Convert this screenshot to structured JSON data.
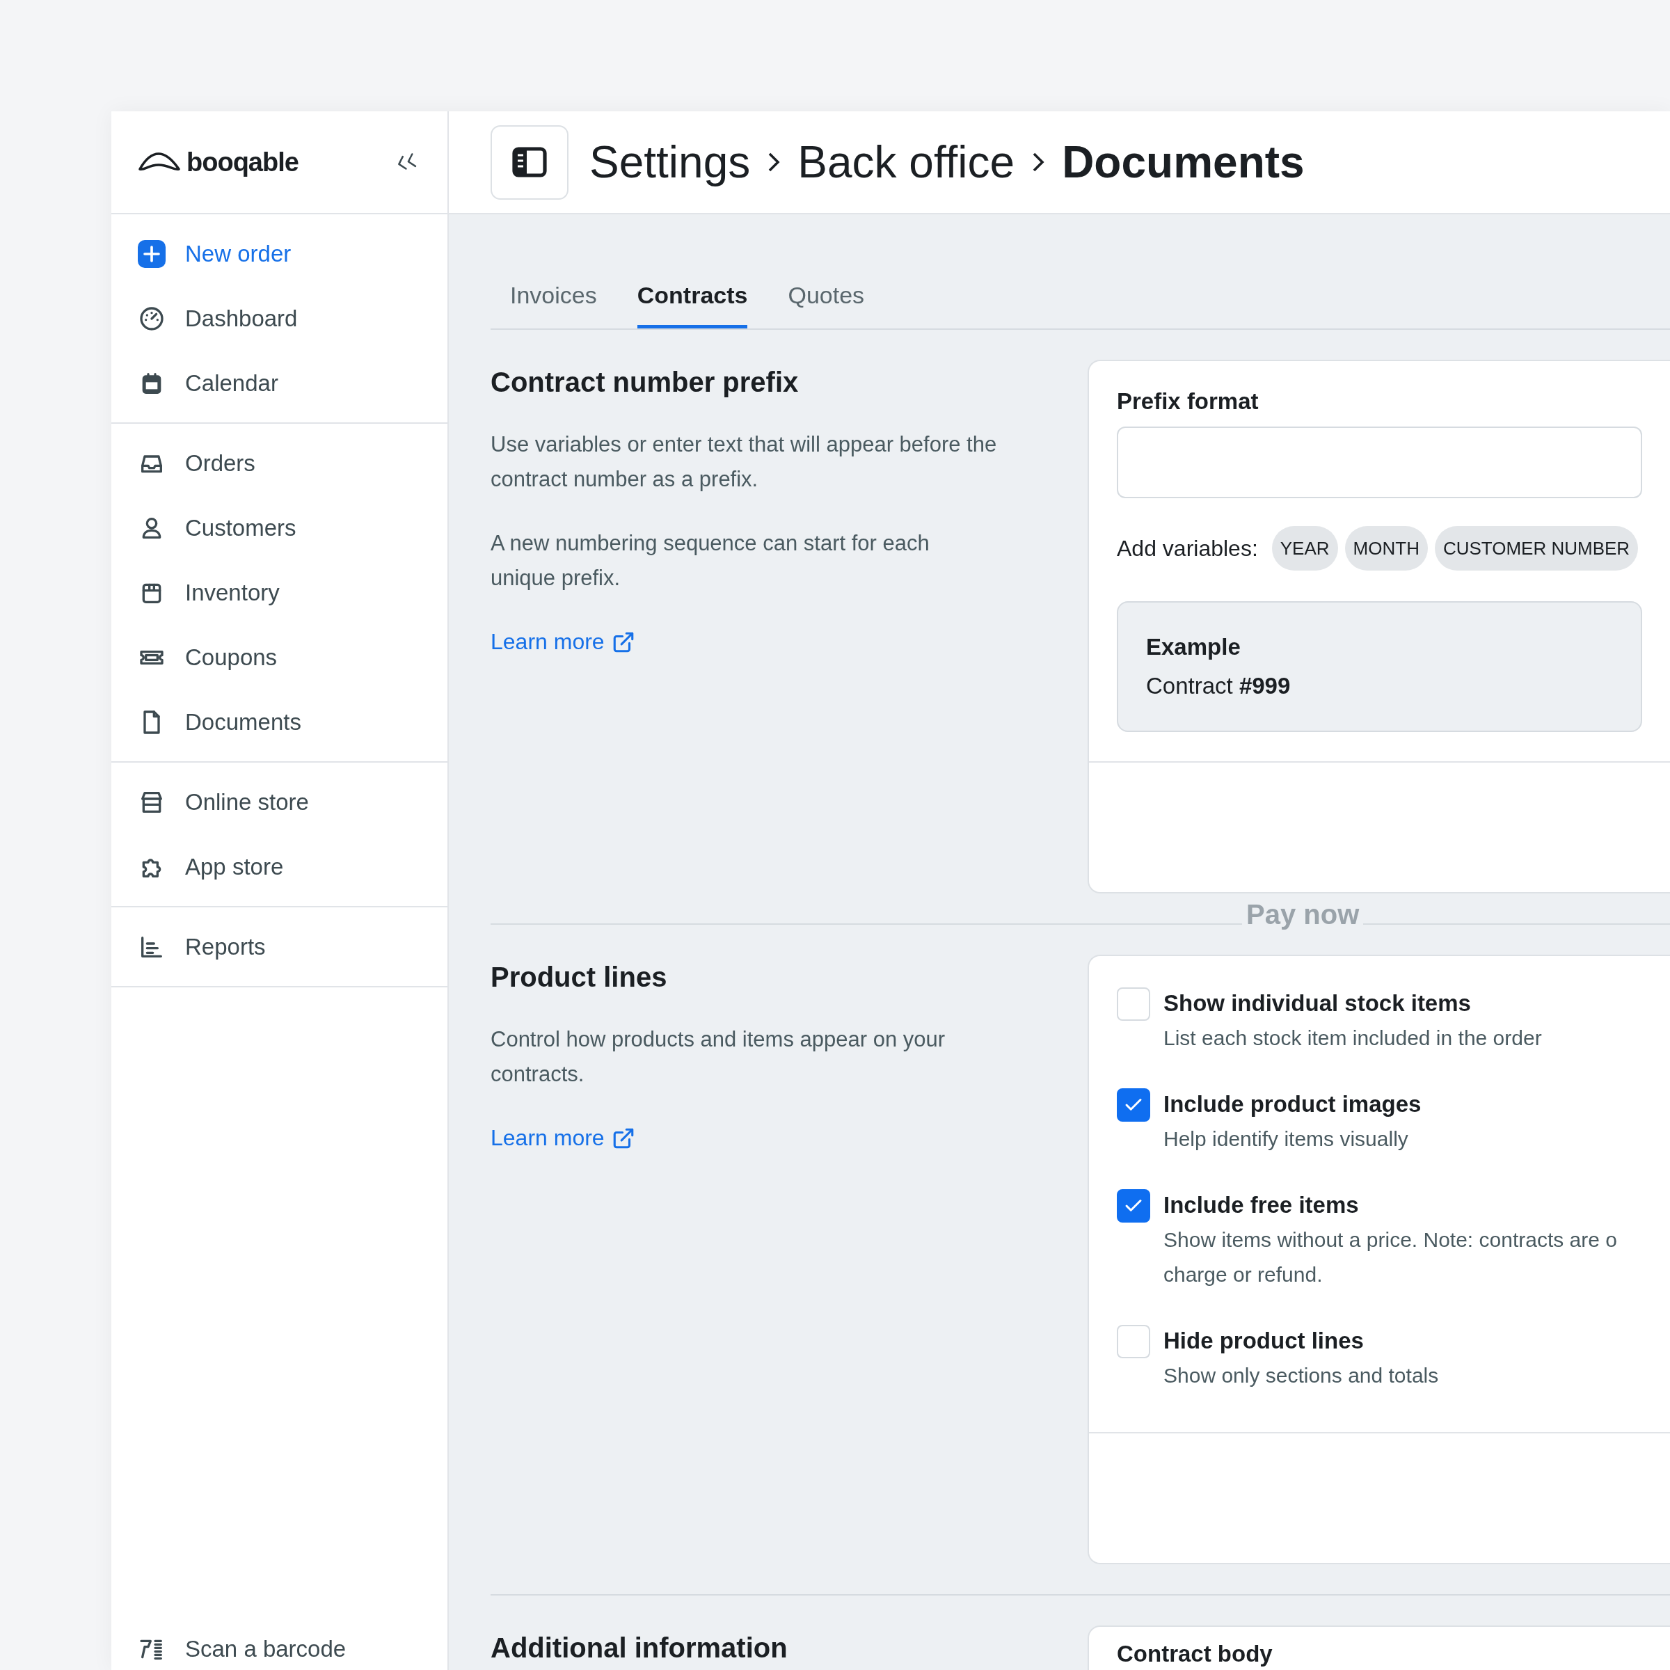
{
  "sidebar": {
    "logo": "booqable",
    "groups": [
      {
        "items": [
          {
            "label": "New order",
            "kind": "action"
          },
          {
            "label": "Dashboard",
            "kind": "link"
          },
          {
            "label": "Calendar",
            "kind": "link"
          }
        ]
      },
      {
        "items": [
          {
            "label": "Orders",
            "kind": "link"
          },
          {
            "label": "Customers",
            "kind": "link"
          },
          {
            "label": "Inventory",
            "kind": "link"
          },
          {
            "label": "Coupons",
            "kind": "link"
          },
          {
            "label": "Documents",
            "kind": "link"
          }
        ]
      },
      {
        "items": [
          {
            "label": "Online store",
            "kind": "link"
          },
          {
            "label": "App store",
            "kind": "link"
          }
        ]
      },
      {
        "items": [
          {
            "label": "Reports",
            "kind": "link"
          }
        ]
      }
    ],
    "footer_item": {
      "label": "Scan a barcode"
    }
  },
  "header": {
    "breadcrumbs": [
      {
        "label": "Settings",
        "current": false
      },
      {
        "label": "Back office",
        "current": false
      },
      {
        "label": "Documents",
        "current": true
      }
    ]
  },
  "tabs": [
    {
      "label": "Invoices",
      "selected": false
    },
    {
      "label": "Contracts",
      "selected": true
    },
    {
      "label": "Quotes",
      "selected": false
    }
  ],
  "sections": [
    {
      "title": "Contract number prefix",
      "paragraphs": [
        "Use variables or enter text that will appear before the contract number as a prefix.",
        "A new numbering sequence can start for each unique prefix."
      ],
      "link": "Learn more",
      "card": {
        "kind": "prefix",
        "label": "Prefix format",
        "variables_label": "Add variables:",
        "variables": [
          "YEAR",
          "MONTH",
          "CUSTOMER NUMBER"
        ],
        "example": {
          "title": "Example",
          "text": "Contract **#999**"
        }
      }
    },
    {
      "title": "Product lines",
      "paragraphs": [
        "Control how products and items appear on your contracts."
      ],
      "link": "Learn more",
      "card": {
        "kind": "options",
        "options": [
          {
            "title": "Show individual stock items",
            "description": [
              "List each stock item included in the order"
            ],
            "checked": false
          },
          {
            "title": "Include product images",
            "description": [
              "Help identify items visually"
            ],
            "checked": true
          },
          {
            "title": "Include free items",
            "description": [
              "Show items without a price. Note: contracts are o",
              "charge or refund."
            ],
            "checked": true
          },
          {
            "title": "Hide product lines",
            "description": [
              "Show only sections and totals"
            ],
            "checked": false
          }
        ]
      }
    },
    {
      "title": "Additional information",
      "card": {
        "kind": "body",
        "label": "Contract body"
      }
    }
  ],
  "floating_label": "Pay now"
}
